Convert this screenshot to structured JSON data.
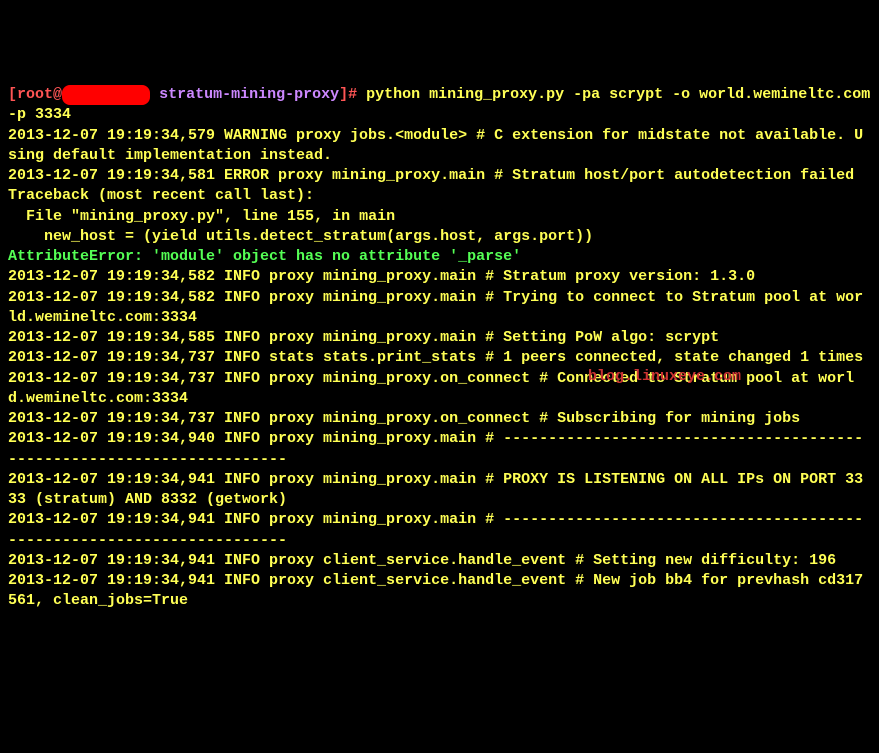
{
  "prompt": {
    "open_bracket": "[",
    "user": "root",
    "at": "@",
    "host_hidden": "        ",
    "close_user_host": "]",
    "space": " ",
    "dir": "stratum-mining-proxy",
    "prompt_symbol": "]# ",
    "command": "python mining_proxy.py -pa scrypt -o world.wemineltc.com -p 3334"
  },
  "lines": {
    "l1": "2013-12-07 19:19:34,579 WARNING proxy jobs.<module> # C extension for midstate not available. Using default implementation instead.",
    "l2": "2013-12-07 19:19:34,581 ERROR proxy mining_proxy.main # Stratum host/port autodetection failed",
    "l3": "Traceback (most recent call last):",
    "l4": "  File \"mining_proxy.py\", line 155, in main",
    "l5": "    new_host = (yield utils.detect_stratum(args.host, args.port))",
    "l6": "AttributeError: 'module' object has no attribute '_parse'",
    "l7": "2013-12-07 19:19:34,582 INFO proxy mining_proxy.main # Stratum proxy version: 1.3.0",
    "l8": "2013-12-07 19:19:34,582 INFO proxy mining_proxy.main # Trying to connect to Stratum pool at world.wemineltc.com:3334",
    "l9": "2013-12-07 19:19:34,585 INFO proxy mining_proxy.main # Setting PoW algo: scrypt",
    "l10": "2013-12-07 19:19:34,737 INFO stats stats.print_stats # 1 peers connected, state changed 1 times",
    "l11": "2013-12-07 19:19:34,737 INFO proxy mining_proxy.on_connect # Connected to Stratum pool at world.wemineltc.com:3334",
    "l12": "2013-12-07 19:19:34,737 INFO proxy mining_proxy.on_connect # Subscribing for mining jobs",
    "l13": "2013-12-07 19:19:34,940 INFO proxy mining_proxy.main # -----------------------------------------------------------------------",
    "l14": "2013-12-07 19:19:34,941 INFO proxy mining_proxy.main # PROXY IS LISTENING ON ALL IPs ON PORT 3333 (stratum) AND 8332 (getwork)",
    "l15": "2013-12-07 19:19:34,941 INFO proxy mining_proxy.main # -----------------------------------------------------------------------",
    "l16": "2013-12-07 19:19:34,941 INFO proxy client_service.handle_event # Setting new difficulty: 196",
    "l17": "2013-12-07 19:19:34,941 INFO proxy client_service.handle_event # New job bb4 for prevhash cd317561, clean_jobs=True"
  },
  "watermark": "blog.linuxeye.com"
}
